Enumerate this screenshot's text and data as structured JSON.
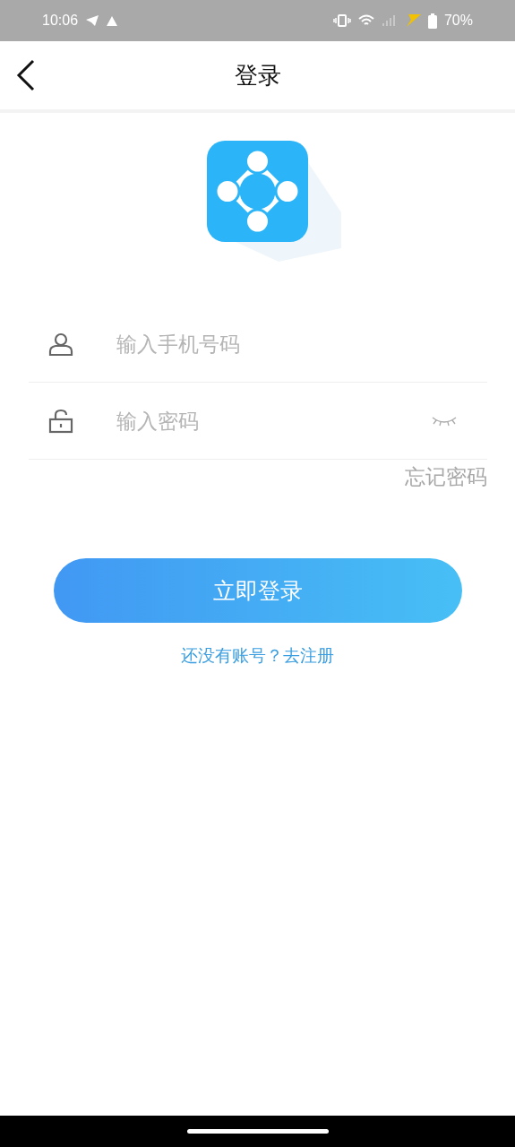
{
  "status_bar": {
    "time": "10:06",
    "battery": "70%"
  },
  "header": {
    "title": "登录"
  },
  "fields": [
    {
      "kind": "phone",
      "placeholder": "输入手机号码"
    },
    {
      "kind": "password",
      "placeholder": "输入密码"
    }
  ],
  "forgot_link": "忘记密码",
  "login_button": "立即登录",
  "register_link": "还没有账号？去注册"
}
